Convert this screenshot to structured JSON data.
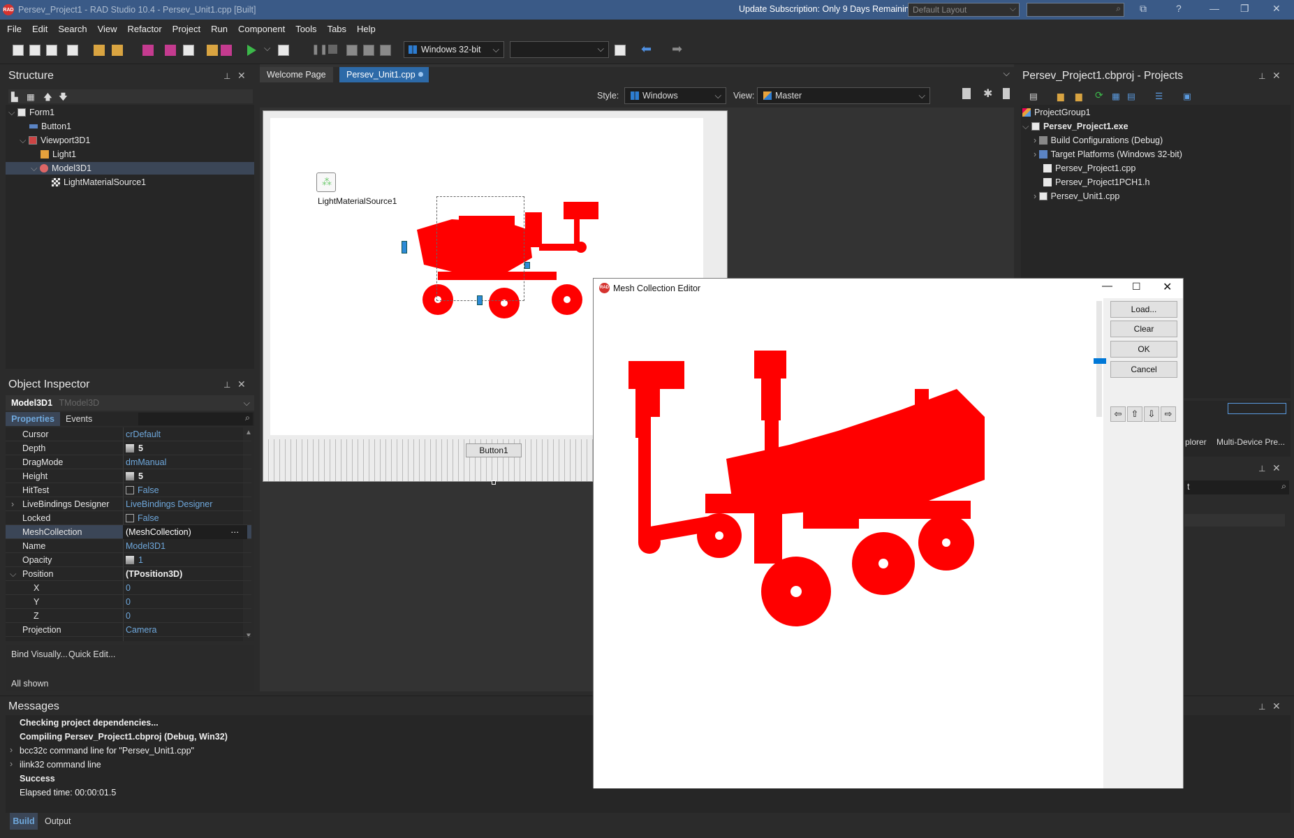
{
  "titlebar": {
    "logo": "RAD",
    "title": "Persev_Project1 - RAD Studio 10.4 - Persev_Unit1.cpp [Built]",
    "subscription_note": "Update Subscription: Only 9 Days Remaining",
    "layout_combo": "Default Layout"
  },
  "menu": [
    "File",
    "Edit",
    "Search",
    "View",
    "Refactor",
    "Project",
    "Run",
    "Component",
    "Tools",
    "Tabs",
    "Help"
  ],
  "toolbar": {
    "platform": "Windows 32-bit"
  },
  "structure": {
    "title": "Structure",
    "items": [
      {
        "label": "Form1"
      },
      {
        "label": "Button1"
      },
      {
        "label": "Viewport3D1"
      },
      {
        "label": "Light1"
      },
      {
        "label": "Model3D1"
      },
      {
        "label": "LightMaterialSource1"
      }
    ]
  },
  "inspector": {
    "title": "Object Inspector",
    "object": "Model3D1",
    "object_type": "TModel3D",
    "tab_properties": "Properties",
    "tab_events": "Events",
    "rows": [
      {
        "k": "Cursor",
        "v": "crDefault"
      },
      {
        "k": "Depth",
        "v": "5"
      },
      {
        "k": "DragMode",
        "v": "dmManual"
      },
      {
        "k": "Height",
        "v": "5"
      },
      {
        "k": "HitTest",
        "v": "False"
      },
      {
        "k": "LiveBindings Designer",
        "v": "LiveBindings Designer"
      },
      {
        "k": "Locked",
        "v": "False"
      },
      {
        "k": "MeshCollection",
        "v": "(MeshCollection)"
      },
      {
        "k": "Name",
        "v": "Model3D1"
      },
      {
        "k": "Opacity",
        "v": "1"
      },
      {
        "k": "Position",
        "v": "(TPosition3D)"
      },
      {
        "k": "X",
        "v": "0"
      },
      {
        "k": "Y",
        "v": "0"
      },
      {
        "k": "Z",
        "v": "0"
      },
      {
        "k": "Projection",
        "v": "Camera"
      }
    ],
    "bind_visually": "Bind Visually...",
    "quick_edit": "Quick Edit...",
    "all_shown": "All shown"
  },
  "editor": {
    "tabs": [
      "Welcome Page",
      "Persev_Unit1.cpp"
    ],
    "style_label": "Style:",
    "style_value": "Windows",
    "view_label": "View:",
    "view_value": "Master",
    "component_label": "LightMaterialSource1",
    "button_label": "Button1"
  },
  "projects": {
    "title": "Persev_Project1.cbproj - Projects",
    "items": [
      {
        "label": "ProjectGroup1"
      },
      {
        "label": "Persev_Project1.exe"
      },
      {
        "label": "Build Configurations (Debug)"
      },
      {
        "label": "Target Platforms (Windows 32-bit)"
      },
      {
        "label": "Persev_Project1.cpp"
      },
      {
        "label": "Persev_Project1PCH1.h"
      },
      {
        "label": "Persev_Unit1.cpp"
      }
    ],
    "tab_explorer": "plorer",
    "tab_multidevice": "Multi-Device Pre...",
    "search_partial": "t"
  },
  "messages": {
    "title": "Messages",
    "lines": [
      "Checking project dependencies...",
      "Compiling Persev_Project1.cbproj (Debug, Win32)",
      "bcc32c command line for \"Persev_Unit1.cpp\"",
      "ilink32 command line",
      "Success",
      "Elapsed time: 00:00:01.5"
    ],
    "tab_build": "Build",
    "tab_output": "Output"
  },
  "dialog": {
    "logo": "RAD",
    "title": "Mesh Collection Editor",
    "load": "Load...",
    "clear": "Clear",
    "ok": "OK",
    "cancel": "Cancel",
    "arrows": [
      "⇦",
      "⇧",
      "⇩",
      "⇨"
    ]
  },
  "colors": {
    "accent": "#3a5a87",
    "model": "#ff0000"
  }
}
